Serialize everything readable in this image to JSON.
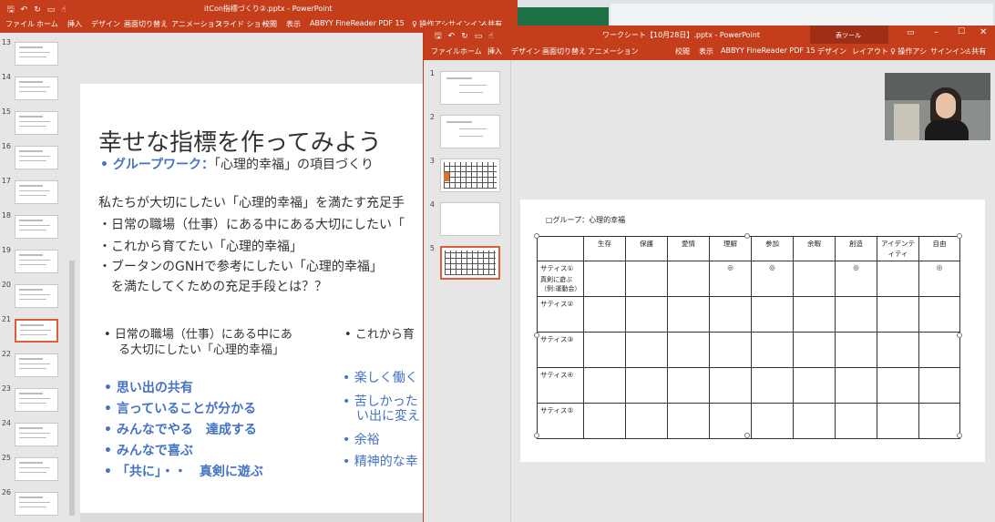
{
  "left_window": {
    "title": "itCon指標づくり②.pptx - PowerPoint",
    "ribbon_tabs": [
      "ファイル",
      "ホーム",
      "挿入",
      "デザイン",
      "画面切り替え",
      "アニメーション",
      "スライド ショー",
      "校閲",
      "表示",
      "ABBYY FineReader PDF 15"
    ],
    "search_label": "操作アシ",
    "signin_label": "サインイン",
    "share_label": "共有",
    "thumb_numbers": [
      "13",
      "14",
      "15",
      "16",
      "17",
      "18",
      "19",
      "20",
      "21",
      "22",
      "23",
      "24",
      "25",
      "26"
    ],
    "slide": {
      "title": "幸せな指標を作ってみよう",
      "subtitle_strong": "グループワーク：",
      "subtitle_rest": "「心理的幸福」の項目づくり",
      "intro": "私たちが大切にしたい「心理的幸福」を満たす充足手",
      "bullet1": "・日常の職場（仕事）にある中にある大切にしたい「",
      "bullet2": "・これから育てたい「心理的幸福」",
      "bullet3": "・ブータンのGNHで参考にしたい「心理的幸福」",
      "bullet3b": "　を満たしてくための充足手段とは？？",
      "col1_head_1": "日常の職場（仕事）にある中にあ",
      "col1_head_2": "る大切にしたい「心理的幸福」",
      "col2_head": "これから育",
      "col1_items": [
        "思い出の共有",
        "言っていることが分かる",
        "みんなでやる　達成する",
        "みんなで喜ぶ",
        "「共に」・・　真剣に遊ぶ"
      ],
      "col2_items": [
        "楽しく働く",
        "苦しかった",
        "い出に変え",
        "余裕",
        "精神的な幸"
      ]
    }
  },
  "right_window": {
    "title": "ワークシート【10月28日】.pptx - PowerPoint",
    "tools_label": "表ツール",
    "ribbon_tabs": [
      "ファイル",
      "ホーム",
      "挿入",
      "デザイン",
      "画面切り替え",
      "アニメーション",
      "校閲",
      "表示",
      "ABBYY FineReader PDF 15",
      "デザイン",
      "レイアウト"
    ],
    "search_label": "操作アシ",
    "signin_label": "サインイン",
    "share_label": "共有",
    "thumb_numbers": [
      "1",
      "2",
      "3",
      "4",
      "5"
    ],
    "slide": {
      "group_label": "□グループ：心理的幸福",
      "headers": [
        "",
        "生存",
        "保護",
        "愛情",
        "理解",
        "参加",
        "余暇",
        "創造",
        "アイデンティティ",
        "自由"
      ],
      "rows": [
        {
          "label": "サティス①",
          "sub": "真剣に遊ぶ（例:運動会）",
          "cells": [
            "",
            "",
            "",
            "◎",
            "◎",
            "",
            "◎",
            "",
            "◎"
          ]
        },
        {
          "label": "サティス②",
          "sub": "",
          "cells": [
            "",
            "",
            "",
            "",
            "",
            "",
            "",
            "",
            ""
          ]
        },
        {
          "label": "サティス③",
          "sub": "",
          "cells": [
            "",
            "",
            "",
            "",
            "",
            "",
            "",
            "",
            ""
          ]
        },
        {
          "label": "サティス④",
          "sub": "",
          "cells": [
            "",
            "",
            "",
            "",
            "",
            "",
            "",
            "",
            ""
          ]
        },
        {
          "label": "サティス⑤",
          "sub": "",
          "cells": [
            "",
            "",
            "",
            "",
            "",
            "",
            "",
            "",
            ""
          ]
        }
      ]
    }
  },
  "colors": {
    "ppt_red": "#c43e1c",
    "bullet_blue": "#4472c4",
    "selection": "#d9603b"
  }
}
